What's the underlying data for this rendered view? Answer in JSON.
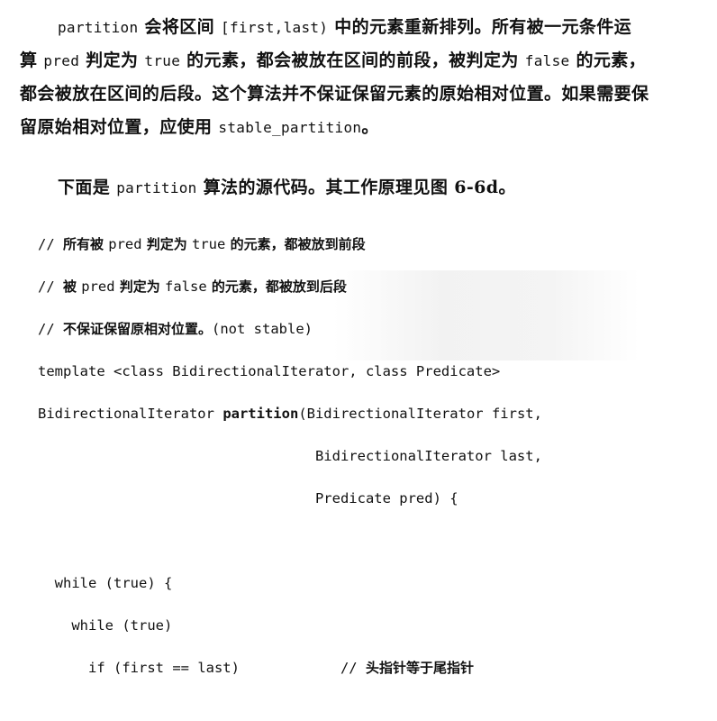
{
  "paragraph_1": {
    "line_1": [
      "partition",
      " 会将区间 ",
      "[first,last)",
      " 中的元素重新排列。所有被一元条件运"
    ],
    "line_2": [
      "算 ",
      "pred",
      " 判定为 ",
      "true",
      " 的元素，都会被放在区间的前段，被判定为 ",
      "false",
      " 的元素，"
    ],
    "line_3": "都会被放在区间的后段。这个算法并不保证保留元素的原始相对位置。如果需要保",
    "line_4": [
      "留原始相对位置，应使用 ",
      "stable_partition",
      "。"
    ]
  },
  "paragraph_2": [
    "下面是 ",
    "partition",
    " 算法的源代码。其工作原理见图 6-6d。"
  ],
  "code": {
    "comment_1": [
      "// ",
      "所有被 ",
      "pred",
      " 判定为 ",
      "true",
      " 的元素，都被放到前段"
    ],
    "comment_2": [
      "// ",
      "被 ",
      "pred",
      " 判定为 ",
      "false",
      " 的元素，都被放到后段"
    ],
    "comment_3": [
      "// ",
      "不保证保留原相对位置。",
      "(not stable)"
    ],
    "template_line": "template <class BidirectionalIterator, class Predicate>",
    "signature_return": "BidirectionalIterator ",
    "signature_name": "partition",
    "signature_param_1": "(BidirectionalIterator first,",
    "signature_param_2": "BidirectionalIterator last,",
    "signature_param_3": "Predicate pred) {",
    "while_outer": "while (true) {",
    "while_inner": "while (true)",
    "if_stmt": "if (first == last)",
    "if_comment": [
      "// ",
      "头指针等于尾指针"
    ]
  }
}
